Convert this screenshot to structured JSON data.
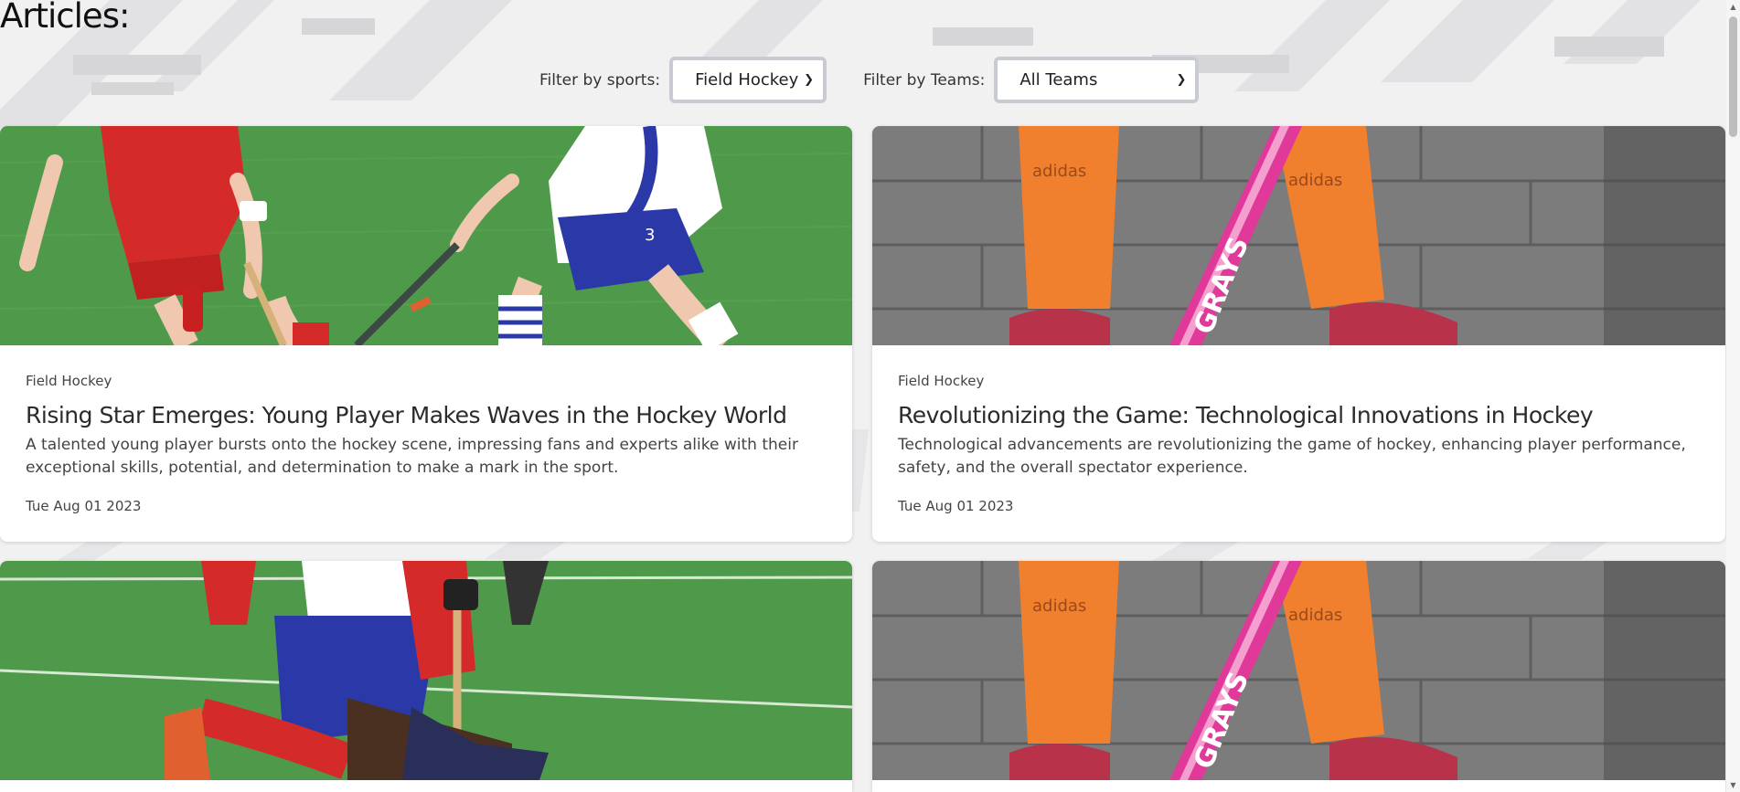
{
  "page": {
    "heading": "Articles:"
  },
  "filters": {
    "sports_label": "Filter by sports:",
    "sports_value": "Field Hockey",
    "teams_label": "Filter by Teams:",
    "teams_value": "All Teams"
  },
  "articles": [
    {
      "category": "Field Hockey",
      "title": "Rising Star Emerges: Young Player Makes Waves in the Hockey World",
      "description": "A talented young player bursts onto the hockey scene, impressing fans and experts alike with their exceptional skills, potential, and determination to make a mark in the sport.",
      "date": "Tue Aug 01 2023",
      "image": "field-hockey-match-photo"
    },
    {
      "category": "Field Hockey",
      "title": "Revolutionizing the Game: Technological Innovations in Hockey",
      "description": "Technological advancements are revolutionizing the game of hockey, enhancing player performance, safety, and the overall spectator experience.",
      "date": "Tue Aug 01 2023",
      "image": "hockey-stick-and-socks-photo"
    },
    {
      "image": "field-hockey-tackle-photo"
    },
    {
      "image": "hockey-stick-and-socks-photo"
    }
  ],
  "image_text": {
    "sock_brand": "adidas",
    "stick_brand": "GRAYS",
    "jersey_number": "3"
  },
  "colors": {
    "page_bg": "#f1f1f2",
    "turf_green": "#4f9a4a",
    "sock_orange": "#f0802e",
    "stick_pink": "#e0399a",
    "jersey_red": "#d42a2a",
    "jersey_blue": "#2b39a8"
  }
}
